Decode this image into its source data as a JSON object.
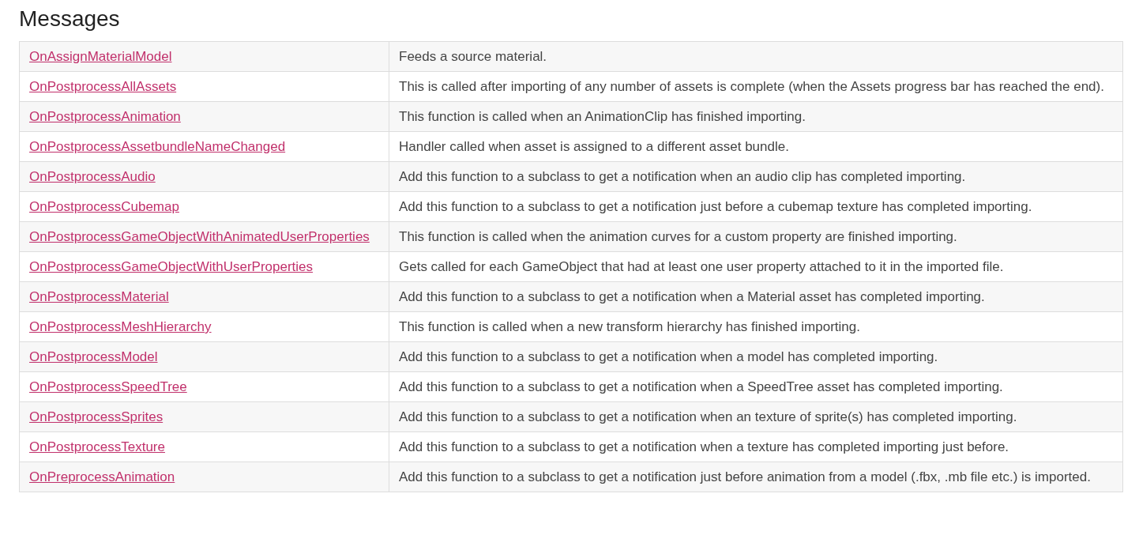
{
  "heading": "Messages",
  "rows": [
    {
      "name": "OnAssignMaterialModel",
      "description": "Feeds a source material."
    },
    {
      "name": "OnPostprocessAllAssets",
      "description": "This is called after importing of any number of assets is complete (when the Assets progress bar has reached the end)."
    },
    {
      "name": "OnPostprocessAnimation",
      "description": "This function is called when an AnimationClip has finished importing."
    },
    {
      "name": "OnPostprocessAssetbundleNameChanged",
      "description": "Handler called when asset is assigned to a different asset bundle."
    },
    {
      "name": "OnPostprocessAudio",
      "description": "Add this function to a subclass to get a notification when an audio clip has completed importing."
    },
    {
      "name": "OnPostprocessCubemap",
      "description": "Add this function to a subclass to get a notification just before a cubemap texture has completed importing."
    },
    {
      "name": "OnPostprocessGameObjectWithAnimatedUserProperties",
      "description": "This function is called when the animation curves for a custom property are finished importing."
    },
    {
      "name": "OnPostprocessGameObjectWithUserProperties",
      "description": "Gets called for each GameObject that had at least one user property attached to it in the imported file."
    },
    {
      "name": "OnPostprocessMaterial",
      "description": "Add this function to a subclass to get a notification when a Material asset has completed importing."
    },
    {
      "name": "OnPostprocessMeshHierarchy",
      "description": "This function is called when a new transform hierarchy has finished importing."
    },
    {
      "name": "OnPostprocessModel",
      "description": "Add this function to a subclass to get a notification when a model has completed importing."
    },
    {
      "name": "OnPostprocessSpeedTree",
      "description": "Add this function to a subclass to get a notification when a SpeedTree asset has completed importing."
    },
    {
      "name": "OnPostprocessSprites",
      "description": "Add this function to a subclass to get a notification when an texture of sprite(s) has completed importing."
    },
    {
      "name": "OnPostprocessTexture",
      "description": "Add this function to a subclass to get a notification when a texture has completed importing just before."
    },
    {
      "name": "OnPreprocessAnimation",
      "description": "Add this function to a subclass to get a notification just before animation from a model (.fbx, .mb file etc.) is imported."
    }
  ]
}
